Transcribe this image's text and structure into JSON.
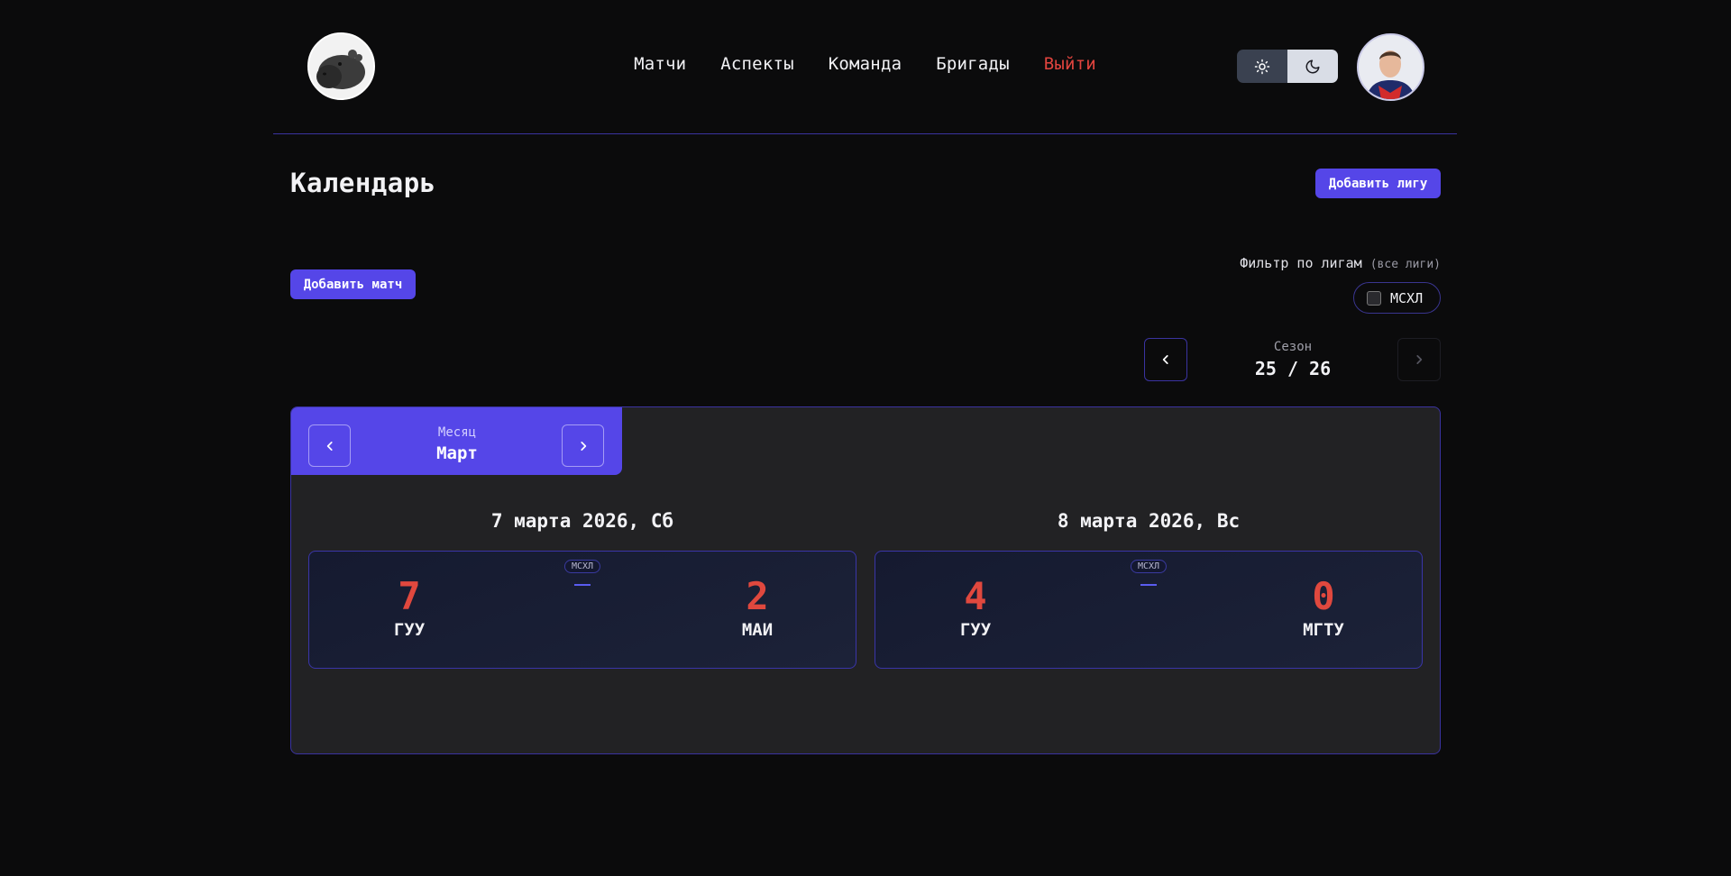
{
  "nav": {
    "items": [
      "Матчи",
      "Аспекты",
      "Команда",
      "Бригады"
    ],
    "logout": "Выйти"
  },
  "page": {
    "title": "Календарь",
    "add_league": "Добавить лигу",
    "add_match": "Добавить матч"
  },
  "filter": {
    "label": "Фильтр по лигам",
    "hint": "(все лиги)",
    "league_chip": "МСХЛ",
    "league_checked": false
  },
  "season": {
    "caption": "Сезон",
    "value": "25 / 26"
  },
  "month": {
    "caption": "Месяц",
    "value": "Март"
  },
  "days": [
    {
      "title": "7 марта 2026, Сб",
      "matches": [
        {
          "league": "МСХЛ",
          "home_team": "ГУУ",
          "home_score": "7",
          "away_team": "МАИ",
          "away_score": "2"
        }
      ]
    },
    {
      "title": "8 марта 2026, Вс",
      "matches": [
        {
          "league": "МСХЛ",
          "home_team": "ГУУ",
          "home_score": "4",
          "away_team": "МГТУ",
          "away_score": "0"
        }
      ]
    }
  ],
  "colors": {
    "accent": "#5546e8",
    "score": "#e0483e",
    "logout": "#e0443e",
    "background": "#0b0b0c",
    "panel": "#222224"
  },
  "icons": {
    "theme_light": "sun-icon",
    "theme_dark": "moon-icon",
    "prev": "chevron-left-icon",
    "next": "chevron-right-icon"
  }
}
